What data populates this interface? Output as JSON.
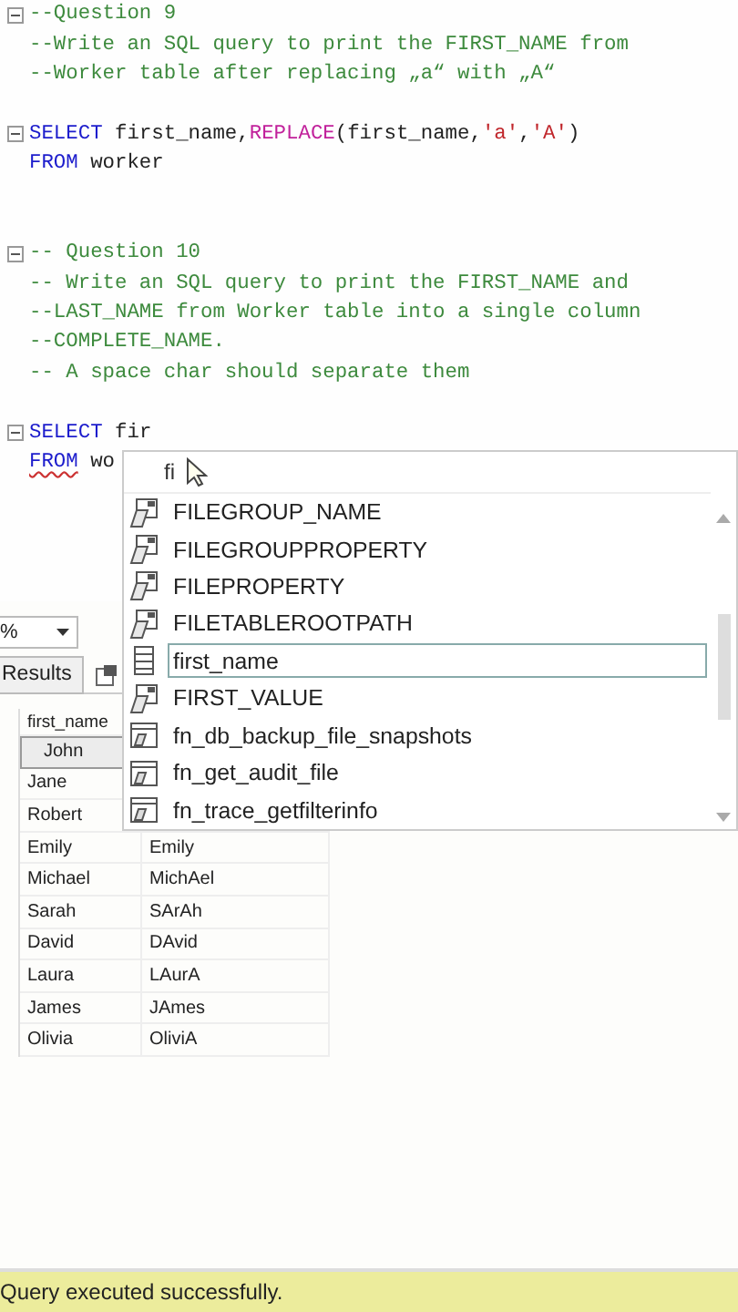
{
  "editor": {
    "lines": [
      {
        "foldable": true,
        "tokens": [
          {
            "kind": "comment",
            "text": "--Question 9"
          }
        ]
      },
      {
        "foldable": false,
        "tokens": [
          {
            "kind": "comment",
            "text": "--Write an SQL query to print the FIRST_NAME from"
          }
        ]
      },
      {
        "foldable": false,
        "tokens": [
          {
            "kind": "comment",
            "text": "--Worker table after replacing „a“ with „A“"
          }
        ]
      },
      {
        "foldable": false
      },
      {
        "foldable": true,
        "tokens": [
          {
            "kind": "keyword",
            "text": "SELECT"
          },
          {
            "kind": "plain",
            "text": " first_name,"
          },
          {
            "kind": "function",
            "text": "REPLACE"
          },
          {
            "kind": "plain",
            "text": "(first_name,"
          },
          {
            "kind": "string",
            "text": "'a'"
          },
          {
            "kind": "plain",
            "text": ","
          },
          {
            "kind": "string",
            "text": "'A'"
          },
          {
            "kind": "plain",
            "text": ")"
          }
        ]
      },
      {
        "foldable": false,
        "tokens": [
          {
            "kind": "keyword",
            "text": "FROM"
          },
          {
            "kind": "plain",
            "text": " worker"
          }
        ]
      },
      {
        "foldable": false
      },
      {
        "foldable": false
      },
      {
        "foldable": true,
        "tokens": [
          {
            "kind": "comment",
            "text": "-- Question 10"
          }
        ]
      },
      {
        "foldable": false,
        "tokens": [
          {
            "kind": "comment",
            "text": "-- Write an SQL query to print the FIRST_NAME and"
          }
        ]
      },
      {
        "foldable": false,
        "tokens": [
          {
            "kind": "comment",
            "text": "--LAST_NAME from Worker table into a single column"
          }
        ]
      },
      {
        "foldable": false,
        "tokens": [
          {
            "kind": "comment",
            "text": "--COMPLETE_NAME."
          }
        ]
      },
      {
        "foldable": false,
        "tokens": [
          {
            "kind": "comment",
            "text": "-- A space char should separate them"
          }
        ]
      },
      {
        "foldable": false
      },
      {
        "foldable": true,
        "tokens": [
          {
            "kind": "keyword",
            "text": "SELECT"
          },
          {
            "kind": "plain",
            "text": " fir"
          }
        ]
      },
      {
        "foldable": false,
        "tokens": [
          {
            "kind": "keyword",
            "text": "FROM",
            "squiggle": true
          },
          {
            "kind": "plain",
            "text": " wo"
          }
        ]
      }
    ]
  },
  "autocomplete": {
    "typed": "fi",
    "items": [
      {
        "kind": "function",
        "label": "FILEGROUP_NAME",
        "selected": false
      },
      {
        "kind": "function",
        "label": "FILEGROUPPROPERTY",
        "selected": false
      },
      {
        "kind": "function",
        "label": "FILEPROPERTY",
        "selected": false
      },
      {
        "kind": "function",
        "label": "FILETABLEROOTPATH",
        "selected": false
      },
      {
        "kind": "column",
        "label": "first_name",
        "selected": true
      },
      {
        "kind": "function",
        "label": "FIRST_VALUE",
        "selected": false
      },
      {
        "kind": "table_function",
        "label": "fn_db_backup_file_snapshots",
        "selected": false
      },
      {
        "kind": "table_function",
        "label": "fn_get_audit_file",
        "selected": false
      },
      {
        "kind": "table_function",
        "label": "fn_trace_getfilterinfo",
        "selected": false
      }
    ]
  },
  "zoom": {
    "value": "%"
  },
  "tabs": [
    {
      "label": "Results",
      "selected": true
    }
  ],
  "grid": {
    "columns": [
      "first_name"
    ],
    "rows": [
      {
        "column_1": "John",
        "selected": true
      },
      {
        "column_1": "Jane",
        "selected": false
      },
      {
        "column_1": "Robert",
        "selected": false
      },
      {
        "column_1": "Emily",
        "column_2": "Emily",
        "selected": false
      },
      {
        "column_1": "Michael",
        "column_2": "MichAel",
        "selected": false
      },
      {
        "column_1": "Sarah",
        "column_2": "SArAh",
        "selected": false
      },
      {
        "column_1": "David",
        "column_2": "DAvid",
        "selected": false
      },
      {
        "column_1": "Laura",
        "column_2": "LAurA",
        "selected": false
      },
      {
        "column_1": "James",
        "column_2": "JAmes",
        "selected": false
      },
      {
        "column_1": "Olivia",
        "column_2": "OliviA",
        "selected": false
      }
    ]
  },
  "status_bar": {
    "message": "Query executed successfully."
  }
}
